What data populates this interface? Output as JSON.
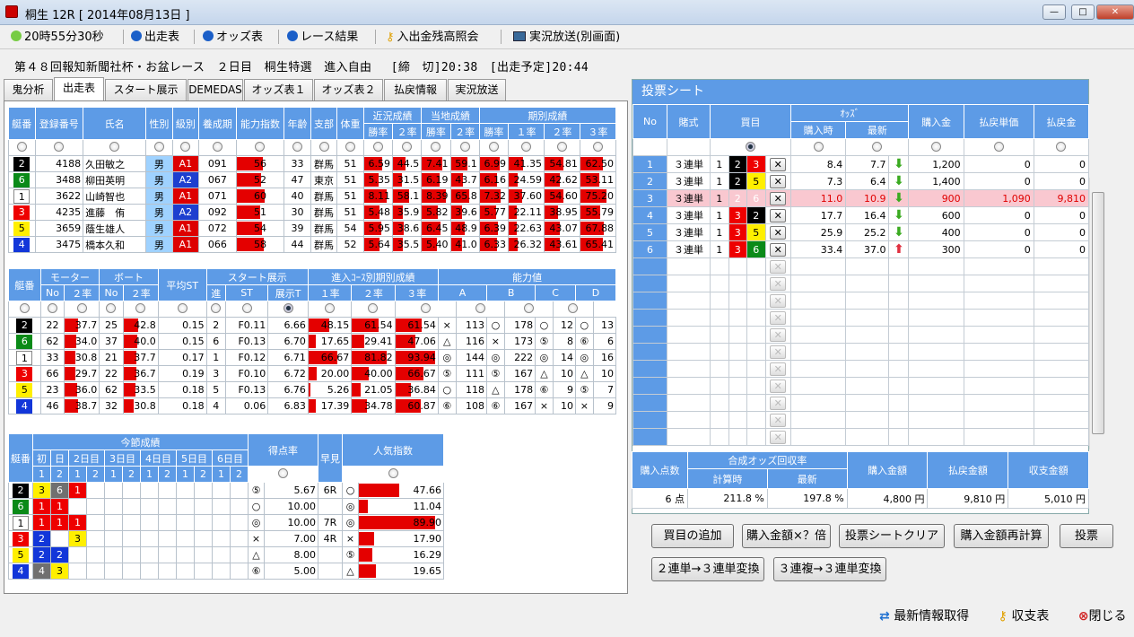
{
  "window": {
    "title": "桐生 12R [ 2014年08月13日 ]"
  },
  "toolbar": {
    "clock": "20時55分30秒",
    "items": [
      "出走表",
      "オッズ表",
      "レース結果",
      "入出金残高照会",
      "実況放送(別画面)"
    ]
  },
  "race_header": "第４８回報知新聞社杯・お盆レース　２日目　桐生特選　進入自由　 [締　切]20:38　[出走予定]20:44",
  "tabs": [
    "鬼分析",
    "出走表",
    "スタート展示",
    "DEMEDAS",
    "オッズ表１",
    "オッズ表２",
    "払戻情報",
    "実況放送"
  ],
  "active_tab": "出走表",
  "racer_table": {
    "headers": [
      "艇番",
      "登録番号",
      "氏名",
      "性別",
      "級別",
      "養成期",
      "能力指数",
      "年齢",
      "支部",
      "体重",
      "近況成績",
      "当地成績",
      "期別成績"
    ],
    "subheaders": [
      "勝率",
      "２率",
      "勝率",
      "２率",
      "勝率",
      "１率",
      "２率",
      "３率"
    ],
    "rows": [
      {
        "waku": "2",
        "reg": "4188",
        "name": "久田敏之",
        "sex": "男",
        "cls": "A1",
        "ki": "091",
        "ab": "56",
        "age": "33",
        "branch": "群馬",
        "wt": "51",
        "r1": "6.59",
        "r2": "44.5",
        "l1": "7.41",
        "l2": "59.1",
        "p1": "6.99",
        "p2": "41.35",
        "p3": "54.81",
        "p4": "62.50"
      },
      {
        "waku": "6",
        "reg": "3488",
        "name": "柳田英明",
        "sex": "男",
        "cls": "A2",
        "ki": "067",
        "ab": "52",
        "age": "47",
        "branch": "東京",
        "wt": "51",
        "r1": "5.35",
        "r2": "31.5",
        "l1": "6.19",
        "l2": "43.7",
        "p1": "6.16",
        "p2": "24.59",
        "p3": "42.62",
        "p4": "53.11"
      },
      {
        "waku": "1",
        "reg": "3622",
        "name": "山崎智也",
        "sex": "男",
        "cls": "A1",
        "ki": "071",
        "ab": "60",
        "age": "40",
        "branch": "群馬",
        "wt": "51",
        "r1": "8.11",
        "r2": "58.1",
        "l1": "8.39",
        "l2": "65.8",
        "p1": "7.32",
        "p2": "37.60",
        "p3": "54.60",
        "p4": "75.20"
      },
      {
        "waku": "3",
        "reg": "4235",
        "name": "進藤　侑",
        "sex": "男",
        "cls": "A2",
        "ki": "092",
        "ab": "51",
        "age": "30",
        "branch": "群馬",
        "wt": "51",
        "r1": "5.48",
        "r2": "35.9",
        "l1": "5.82",
        "l2": "39.6",
        "p1": "5.77",
        "p2": "22.11",
        "p3": "38.95",
        "p4": "55.79"
      },
      {
        "waku": "5",
        "reg": "3659",
        "name": "蔭生雄人",
        "sex": "男",
        "cls": "A1",
        "ki": "072",
        "ab": "54",
        "age": "39",
        "branch": "群馬",
        "wt": "54",
        "r1": "5.95",
        "r2": "38.6",
        "l1": "6.45",
        "l2": "48.9",
        "p1": "6.39",
        "p2": "22.63",
        "p3": "43.07",
        "p4": "67.88"
      },
      {
        "waku": "4",
        "reg": "3475",
        "name": "橋本久和",
        "sex": "男",
        "cls": "A1",
        "ki": "066",
        "ab": "58",
        "age": "44",
        "branch": "群馬",
        "wt": "52",
        "r1": "5.64",
        "r2": "35.5",
        "l1": "5.40",
        "l2": "41.0",
        "p1": "6.33",
        "p2": "26.32",
        "p3": "43.61",
        "p4": "65.41"
      }
    ]
  },
  "motor_table": {
    "headers": [
      "艇番",
      "モーター",
      "ボート",
      "平均ST",
      "スタート展示",
      "進入ｺｰｽ別期別成績",
      "能力値"
    ],
    "subheaders": [
      "No",
      "２率",
      "No",
      "２率",
      "進",
      "ST",
      "展示T",
      "１率",
      "２率",
      "３率",
      "A",
      "B",
      "C",
      "D"
    ],
    "rows": [
      {
        "waku": "2",
        "mno": "22",
        "m2": "37.7",
        "bno": "25",
        "b2": "42.8",
        "st": "0.15",
        "sin": "2",
        "sst": "F0.11",
        "tenji": "6.66",
        "c1": "48.15",
        "c2": "61.54",
        "c3": "61.54",
        "aM": "×",
        "a": "113",
        "bM": "○",
        "b": "178",
        "cM": "○",
        "c": "12",
        "dM": "○",
        "d": "13"
      },
      {
        "waku": "6",
        "mno": "62",
        "m2": "34.0",
        "bno": "37",
        "b2": "40.0",
        "st": "0.15",
        "sin": "6",
        "sst": "F0.13",
        "tenji": "6.70",
        "c1": "17.65",
        "c2": "29.41",
        "c3": "47.06",
        "aM": "△",
        "a": "116",
        "bM": "×",
        "b": "173",
        "cM": "⑤",
        "c": "8",
        "dM": "⑥",
        "d": "6"
      },
      {
        "waku": "1",
        "mno": "33",
        "m2": "30.8",
        "bno": "21",
        "b2": "37.7",
        "st": "0.17",
        "sin": "1",
        "sst": "F0.12",
        "tenji": "6.71",
        "c1": "66.67",
        "c2": "81.82",
        "c3": "93.94",
        "aM": "◎",
        "a": "144",
        "bM": "◎",
        "b": "222",
        "cM": "◎",
        "c": "14",
        "dM": "◎",
        "d": "16"
      },
      {
        "waku": "3",
        "mno": "66",
        "m2": "29.7",
        "bno": "22",
        "b2": "36.7",
        "st": "0.19",
        "sin": "3",
        "sst": "F0.10",
        "tenji": "6.72",
        "c1": "20.00",
        "c2": "40.00",
        "c3": "66.67",
        "aM": "⑤",
        "a": "111",
        "bM": "⑤",
        "b": "167",
        "cM": "△",
        "c": "10",
        "dM": "△",
        "d": "10"
      },
      {
        "waku": "5",
        "mno": "23",
        "m2": "36.0",
        "bno": "62",
        "b2": "33.5",
        "st": "0.18",
        "sin": "5",
        "sst": "F0.13",
        "tenji": "6.76",
        "c1": "5.26",
        "c2": "21.05",
        "c3": "36.84",
        "aM": "○",
        "a": "118",
        "bM": "△",
        "b": "178",
        "cM": "⑥",
        "c": "9",
        "dM": "⑤",
        "d": "7"
      },
      {
        "waku": "4",
        "mno": "46",
        "m2": "38.7",
        "bno": "32",
        "b2": "30.8",
        "st": "0.18",
        "sin": "4",
        "sst": "0.06",
        "tenji": "6.83",
        "c1": "17.39",
        "c2": "34.78",
        "c3": "60.87",
        "aM": "⑥",
        "a": "108",
        "bM": "⑥",
        "b": "167",
        "cM": "×",
        "c": "10",
        "dM": "×",
        "d": "9"
      }
    ]
  },
  "series_table": {
    "headers": [
      "艇番",
      "今節成績",
      "得点率",
      "早見",
      "人気指数"
    ],
    "days": [
      "初",
      "日",
      "2日目",
      "3日目",
      "4日目",
      "5日目",
      "6日目"
    ],
    "races": [
      "1",
      "2",
      "1",
      "2",
      "1",
      "2",
      "1",
      "2",
      "1",
      "2",
      "1",
      "2"
    ],
    "rows": [
      {
        "waku": "2",
        "res": [
          "3",
          "6",
          "1",
          "",
          "",
          "",
          "",
          "",
          "",
          "",
          "",
          ""
        ],
        "mark": "⑤",
        "score": "5.67",
        "hayami": "6R",
        "pm": "○",
        "pop": "47.66"
      },
      {
        "waku": "6",
        "res": [
          "1",
          "1",
          "",
          "",
          "",
          "",
          "",
          "",
          "",
          "",
          "",
          ""
        ],
        "mark": "○",
        "score": "10.00",
        "hayami": "",
        "pm": "◎",
        "pop": "11.04"
      },
      {
        "waku": "1",
        "res": [
          "1",
          "1",
          "1",
          "",
          "",
          "",
          "",
          "",
          "",
          "",
          "",
          ""
        ],
        "mark": "◎",
        "score": "10.00",
        "hayami": "7R",
        "pm": "◎",
        "pop": "89.90"
      },
      {
        "waku": "3",
        "res": [
          "2",
          "",
          "3",
          "",
          "",
          "",
          "",
          "",
          "",
          "",
          "",
          ""
        ],
        "mark": "×",
        "score": "7.00",
        "hayami": "4R",
        "pm": "×",
        "pop": "17.90"
      },
      {
        "waku": "5",
        "res": [
          "2",
          "2",
          "",
          "",
          "",
          "",
          "",
          "",
          "",
          "",
          "",
          ""
        ],
        "mark": "△",
        "score": "8.00",
        "hayami": "",
        "pm": "⑤",
        "pop": "16.29"
      },
      {
        "waku": "4",
        "res": [
          "4",
          "3",
          "",
          "",
          "",
          "",
          "",
          "",
          "",
          "",
          "",
          ""
        ],
        "mark": "⑥",
        "score": "5.00",
        "hayami": "",
        "pm": "△",
        "pop": "19.65"
      }
    ]
  },
  "bet_sheet": {
    "title": "投票シート",
    "headers": [
      "No",
      "賭式",
      "買目",
      "ｵｯｽﾞ",
      "購入金",
      "払戻単価",
      "払戻金"
    ],
    "odds_sub": [
      "購入時",
      "最新"
    ],
    "rows": [
      {
        "no": "1",
        "type": "３連単",
        "a": "1",
        "b": "2",
        "c": "3",
        "bo": "8.4",
        "lo": "7.7",
        "dir": "down",
        "amt": "1,200",
        "unit": "0",
        "pay": "0"
      },
      {
        "no": "2",
        "type": "３連単",
        "a": "1",
        "b": "2",
        "c": "5",
        "bo": "7.3",
        "lo": "6.4",
        "dir": "down",
        "amt": "1,400",
        "unit": "0",
        "pay": "0"
      },
      {
        "no": "3",
        "type": "３連単",
        "a": "1",
        "b": "2",
        "c": "6",
        "bo": "11.0",
        "lo": "10.9",
        "dir": "down",
        "amt": "900",
        "unit": "1,090",
        "pay": "9,810"
      },
      {
        "no": "4",
        "type": "３連単",
        "a": "1",
        "b": "3",
        "c": "2",
        "bo": "17.7",
        "lo": "16.4",
        "dir": "down",
        "amt": "600",
        "unit": "0",
        "pay": "0"
      },
      {
        "no": "5",
        "type": "３連単",
        "a": "1",
        "b": "3",
        "c": "5",
        "bo": "25.9",
        "lo": "25.2",
        "dir": "down",
        "amt": "400",
        "unit": "0",
        "pay": "0"
      },
      {
        "no": "6",
        "type": "３連単",
        "a": "1",
        "b": "3",
        "c": "6",
        "bo": "33.4",
        "lo": "37.0",
        "dir": "up",
        "amt": "300",
        "unit": "0",
        "pay": "0"
      }
    ],
    "empty_rows": 11
  },
  "summary": {
    "h_points": "購入点数",
    "h_synth": "合成オッズ回収率",
    "h_at": "計算時",
    "h_latest": "最新",
    "h_amount": "購入金額",
    "h_payout": "払戻金額",
    "h_balance": "収支金額",
    "points": "6 点",
    "at": "211.8 %",
    "latest": "197.8 %",
    "amount": "4,800 円",
    "payout": "9,810 円",
    "balance": "5,010 円"
  },
  "buttons": {
    "add": "買目の追加",
    "mult": "購入金額×？倍",
    "clear": "投票シートクリア",
    "recalc": "購入金額再計算",
    "vote": "投票",
    "conv2": "２連単→３連単変換",
    "conv3": "３連複→３連単変換"
  },
  "footer": {
    "refresh": "最新情報取得",
    "balance": "収支表",
    "close": "閉じる"
  },
  "colors": {
    "header_blue": "#5d9be6",
    "bar_red": "#e40000",
    "highlight_row": "#f9c8d0"
  }
}
